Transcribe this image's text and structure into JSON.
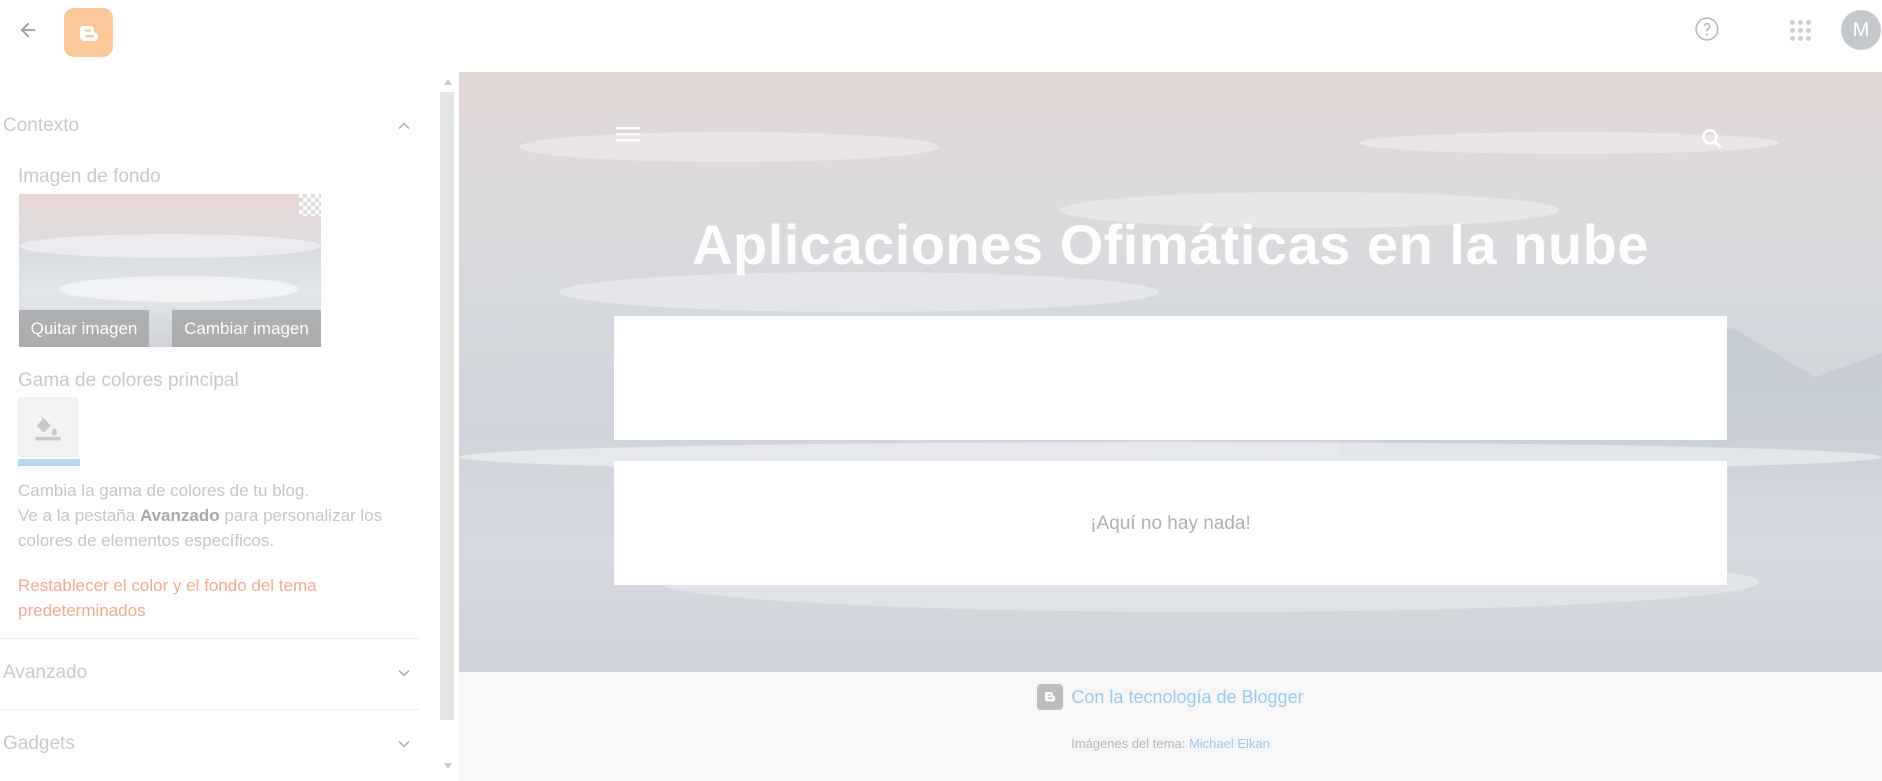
{
  "topbar": {
    "back_icon": "arrow-left-icon",
    "logo_icon": "blogger-logo-icon",
    "help_icon": "help-circle-icon",
    "apps_icon": "apps-grid-icon",
    "avatar_letter": "M"
  },
  "sidebar": {
    "context": {
      "title": "Contexto",
      "background_image_label": "Imagen de fondo",
      "remove_image": "Quitar imagen",
      "change_image": "Cambiar imagen",
      "color_scheme_label": "Gama de colores principal",
      "swatch_icon": "paint-bucket-icon",
      "help_line1": "Cambia la gama de colores de tu blog.",
      "help_line2_pre": "Ve a la pestaña ",
      "help_line2_bold": "Avanzado",
      "help_line2_post": " para personalizar los colores de elementos específicos.",
      "reset_link": "Restablecer el color y el fondo del tema predeterminados"
    },
    "advanced": {
      "title": "Avanzado"
    },
    "gadgets": {
      "title": "Gadgets"
    }
  },
  "preview": {
    "blog_title": "Aplicaciones Ofimáticas en la nube",
    "empty_message": "¡Aquí no hay nada!",
    "powered_by": "Con la tecnología de Blogger",
    "credit_prefix": "Imágenes del tema:",
    "credit_author": "Michael Elkan"
  },
  "colors": {
    "accent_link": "#9cc8ef",
    "reset_link": "#f5a98f",
    "logo": "#fbc89a"
  }
}
